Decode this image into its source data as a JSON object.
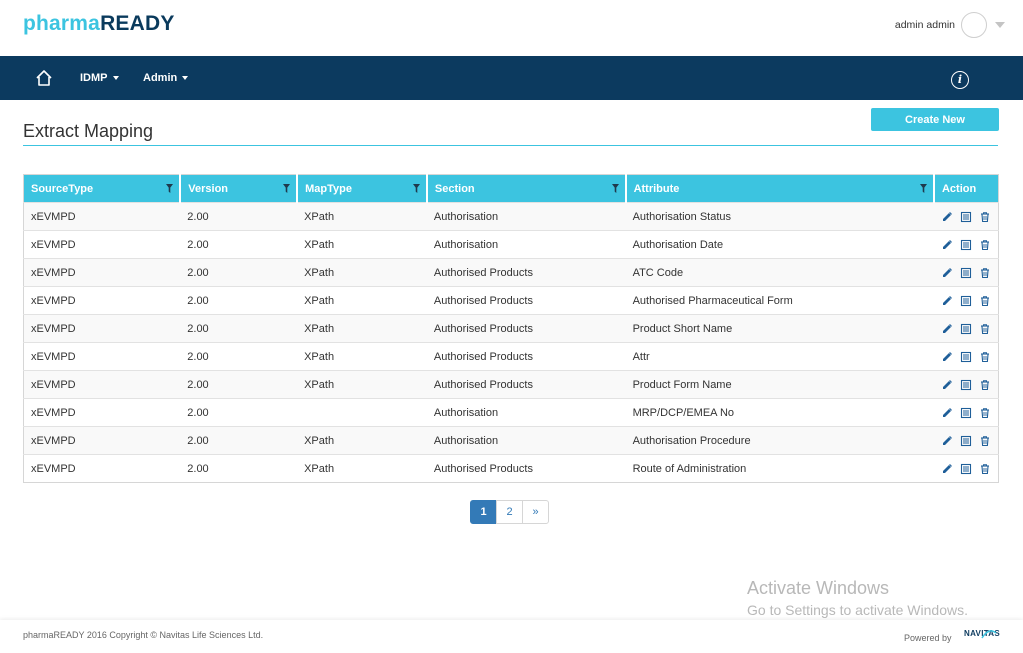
{
  "brand": {
    "part1": "pharma",
    "part2": "READY"
  },
  "user": {
    "name": "admin admin"
  },
  "nav": {
    "idmp": "IDMP",
    "admin": "Admin",
    "info_glyph": "i"
  },
  "page": {
    "title": "Extract Mapping",
    "create_label": "Create New"
  },
  "table": {
    "headers": [
      "SourceType",
      "Version",
      "MapType",
      "Section",
      "Attribute",
      "Action"
    ],
    "rows": [
      [
        "xEVMPD",
        "2.00",
        "XPath",
        "Authorisation",
        "Authorisation Status"
      ],
      [
        "xEVMPD",
        "2.00",
        "XPath",
        "Authorisation",
        "Authorisation Date"
      ],
      [
        "xEVMPD",
        "2.00",
        "XPath",
        "Authorised Products",
        "ATC Code"
      ],
      [
        "xEVMPD",
        "2.00",
        "XPath",
        "Authorised Products",
        "Authorised Pharmaceutical Form"
      ],
      [
        "xEVMPD",
        "2.00",
        "XPath",
        "Authorised Products",
        "Product Short Name"
      ],
      [
        "xEVMPD",
        "2.00",
        "XPath",
        "Authorised Products",
        "Attr"
      ],
      [
        "xEVMPD",
        "2.00",
        "XPath",
        "Authorised Products",
        "Product Form Name"
      ],
      [
        "xEVMPD",
        "2.00",
        "",
        "Authorisation",
        "MRP/DCP/EMEA No"
      ],
      [
        "xEVMPD",
        "2.00",
        "XPath",
        "Authorisation",
        "Authorisation Procedure"
      ],
      [
        "xEVMPD",
        "2.00",
        "XPath",
        "Authorised Products",
        "Route of Administration"
      ]
    ],
    "action_icons": [
      "edit-icon",
      "details-icon",
      "trash-icon"
    ]
  },
  "pagination": {
    "pages": [
      "1",
      "2"
    ],
    "next": "»",
    "current": "1"
  },
  "watermark": {
    "title": "Activate Windows",
    "subtitle": "Go to Settings to activate Windows."
  },
  "footer": {
    "copyright": "pharmaREADY 2016 Copyright © Navitas Life Sciences Ltd.",
    "powered_by": "Powered by",
    "partner": "NAVITAS"
  },
  "colors": {
    "accent": "#3cc4e0",
    "navbar": "#0c3a5f",
    "link": "#337ab7"
  }
}
